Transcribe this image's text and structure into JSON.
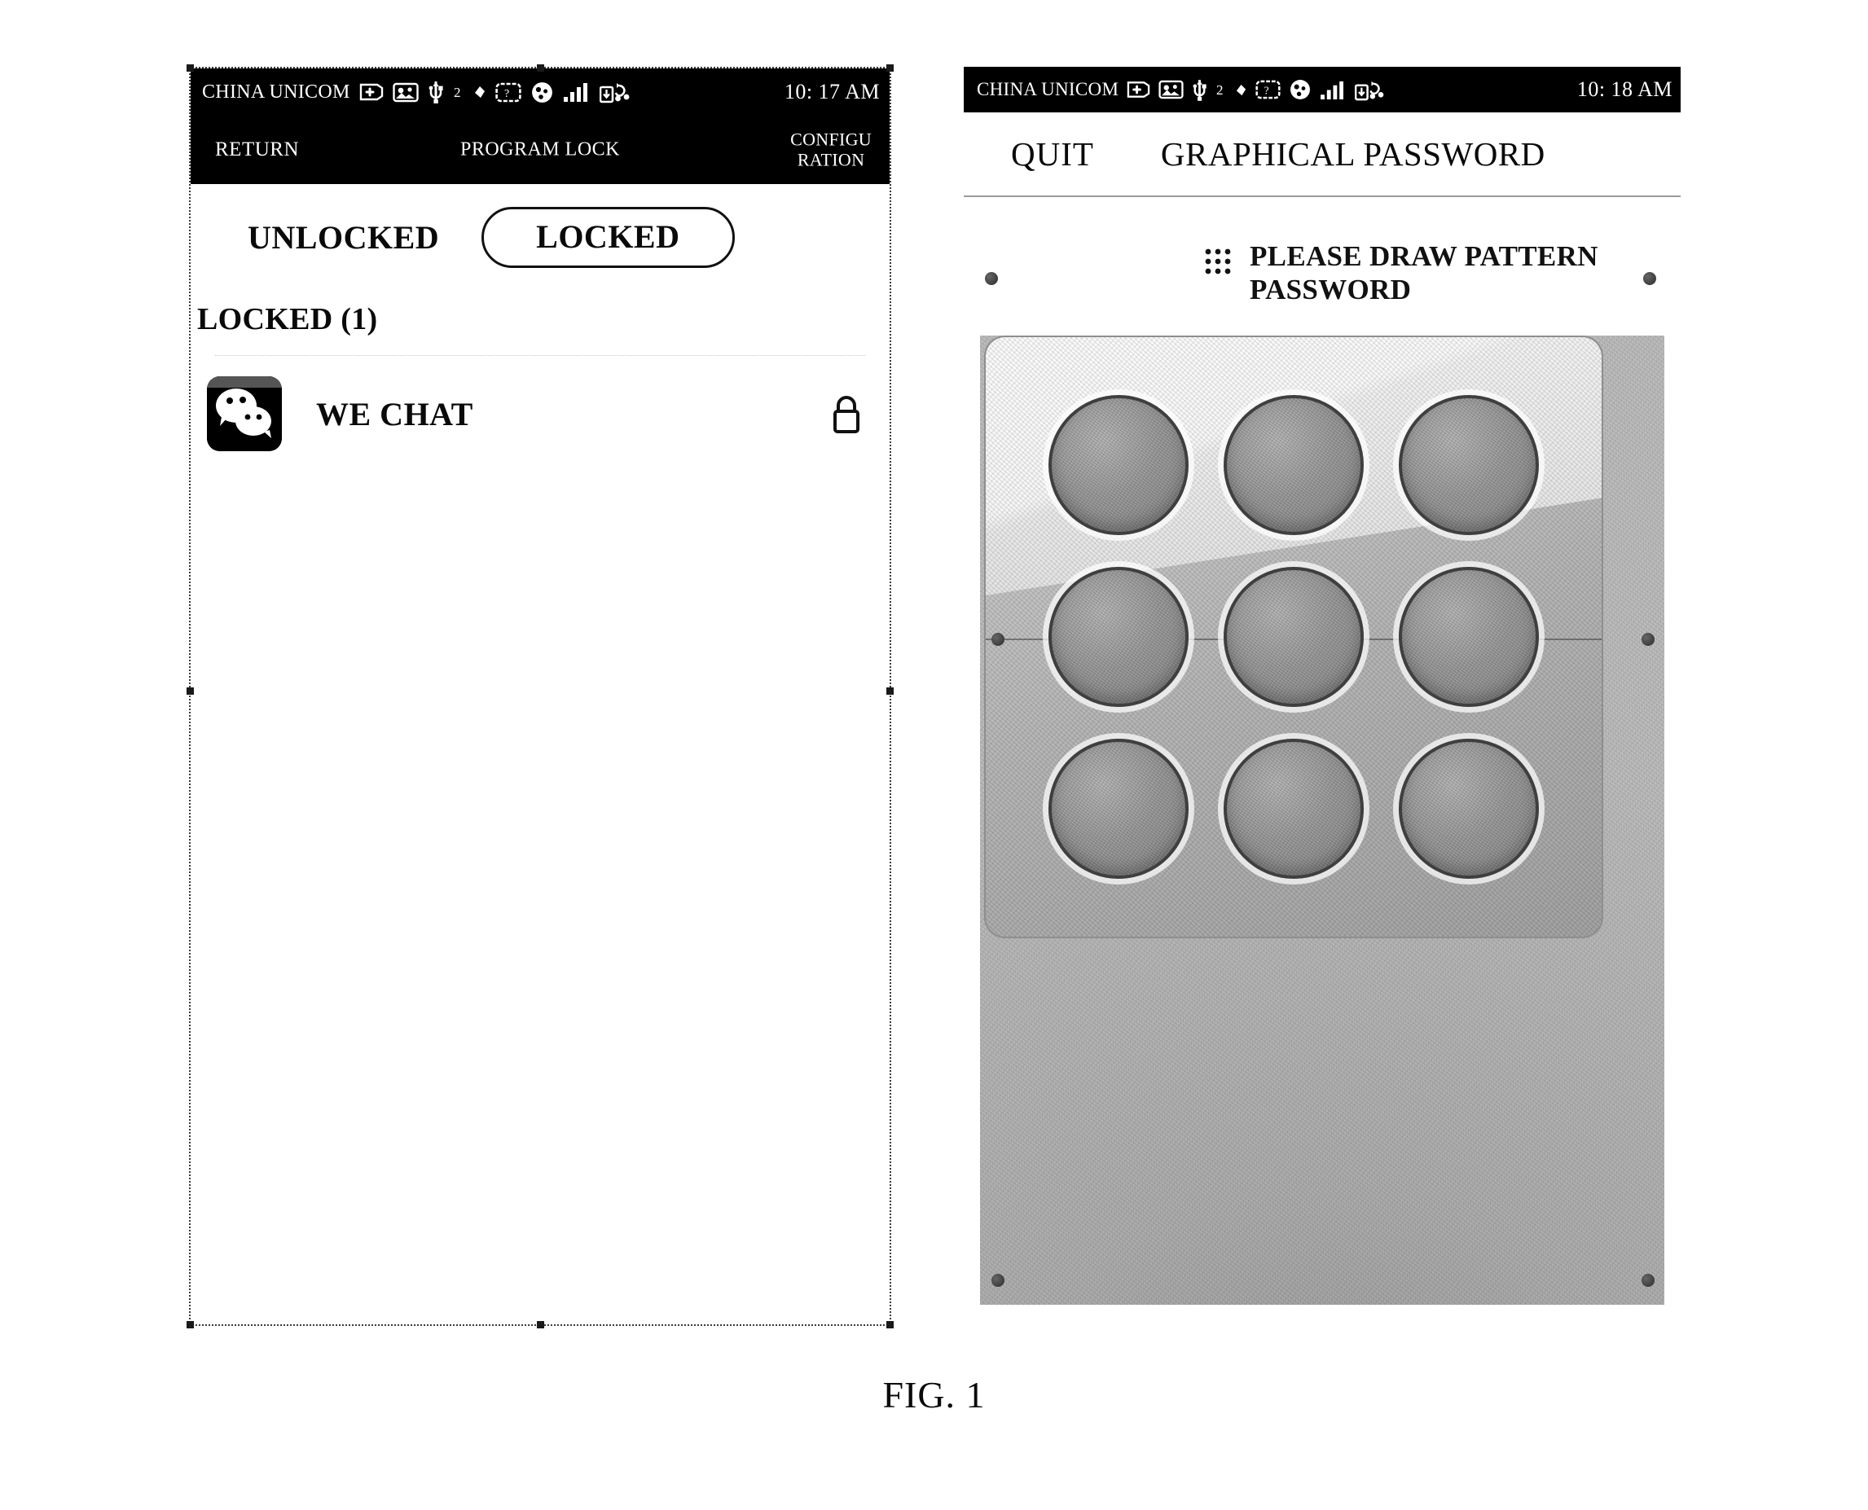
{
  "figure": {
    "caption": "FIG. 1"
  },
  "left_phone": {
    "status_bar": {
      "carrier": "CHINA UNICOM",
      "time": "10: 17 AM",
      "icons": [
        "plus-badge-icon",
        "photo-badge-icon",
        "usb-icon",
        "numeral-2-icon",
        "small-diamond-icon",
        "screenshot-badge-icon",
        "circle-badge-icon",
        "signal-bars-icon",
        "download-upload-icon"
      ]
    },
    "nav_bar": {
      "back_label": "RETURN",
      "title": "PROGRAM LOCK",
      "action_line1": "CONFIGU",
      "action_line2": "RATION"
    },
    "tabs": [
      {
        "label": "UNLOCKED",
        "selected": false
      },
      {
        "label": "LOCKED",
        "selected": true
      }
    ],
    "section_label": "LOCKED (1)",
    "apps": [
      {
        "name": "WE CHAT",
        "icon": "wechat-icon",
        "status_icon": "lock-closed-icon"
      }
    ]
  },
  "right_phone": {
    "status_bar": {
      "carrier": "CHINA UNICOM",
      "time": "10: 18 AM",
      "icons": [
        "plus-badge-icon",
        "photo-badge-icon",
        "usb-icon",
        "numeral-2-icon",
        "small-diamond-icon",
        "screenshot-badge-icon",
        "circle-badge-icon",
        "signal-bars-icon",
        "download-upload-icon"
      ]
    },
    "header": {
      "quit_label": "QUIT",
      "title": "GRAPHICAL PASSWORD"
    },
    "prompt": {
      "icon": "pattern-grid-icon",
      "text": "PLEASE DRAW PATTERN PASSWORD"
    },
    "pattern_grid": {
      "rows": 3,
      "columns": 3,
      "node_count": 9,
      "drawn_path": []
    }
  },
  "colors": {
    "status_bar_bg": "#000000",
    "status_bar_fg": "#ffffff",
    "page_bg": "#ffffff",
    "text": "#0a0a0a",
    "border_dotted": "#3a3a3a"
  }
}
